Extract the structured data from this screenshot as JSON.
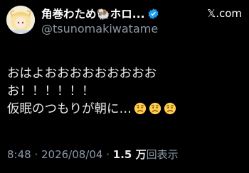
{
  "author": {
    "name": "角巻わため🐏ホロ...",
    "handle": "@tsunomakiwatame",
    "verified": true,
    "avatar_icon": "avatar-image"
  },
  "brand": {
    "label": "𝕏.com",
    "icon": "x-logo-icon"
  },
  "tweet": {
    "lines": [
      "おはよおおおおおおおおお",
      "お！！！！！！",
      "仮眠のつもりが朝に…"
    ],
    "trailing_emoji": [
      "worried-face-icon",
      "worried-face-icon",
      "worried-face-icon"
    ]
  },
  "meta": {
    "time": "8:48",
    "separator1": " · ",
    "date": "2026/08/04",
    "separator2": " · ",
    "views_count": "1.5 万",
    "views_label": "回表示"
  },
  "colors": {
    "background": "#000000",
    "text": "#e7e9ea",
    "muted": "#8b98a5",
    "verified": "#1d9bf0"
  }
}
